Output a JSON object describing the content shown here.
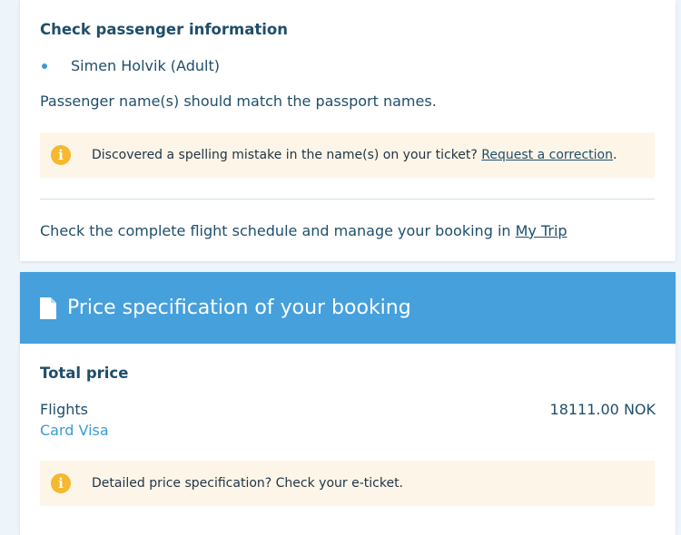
{
  "passenger_section": {
    "title": "Check passenger information",
    "passengers": [
      "Simen Holvik (Adult)"
    ],
    "name_note": "Passenger name(s) should match the passport names.",
    "spelling_notice": {
      "icon": "info-icon",
      "icon_glyph": "i",
      "text": "Discovered a spelling mistake in the name(s) on your ticket? ",
      "link_label": "Request a correction",
      "suffix": "."
    },
    "manage": {
      "text": "Check the complete flight schedule and manage your booking in ",
      "link_label": "My Trip"
    }
  },
  "price_section": {
    "icon": "document-icon",
    "title": "Price specification of your booking",
    "total_label": "Total price",
    "flights_label": "Flights",
    "flights_amount": "18111.00 NOK",
    "payment_method": "Card Visa",
    "price_notice": {
      "icon": "info-icon",
      "icon_glyph": "i",
      "text": "Detailed price specification? Check your e-ticket."
    }
  },
  "colors": {
    "banner": "#45a0dc",
    "text": "#1f4e6b",
    "notice_bg": "#fdf5e8",
    "info_icon": "#f5b82e",
    "accent": "#3b9bd6"
  }
}
